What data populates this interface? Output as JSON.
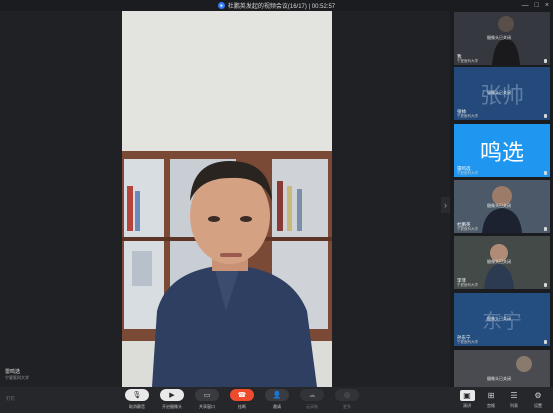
{
  "window": {
    "title": "杜鹏英发起的视频会议(16/17) | 00:52:57",
    "controls": [
      "—",
      "□",
      "×"
    ]
  },
  "main_speaker": {
    "name": "雷鸣选",
    "org": "宁夏医科大学"
  },
  "brand": "钉钉",
  "participants": [
    {
      "name": "我",
      "org": "宁夏医科大学",
      "camera_status": "摄像头已关闭",
      "avatar_text": "",
      "bg": "#2c2e33"
    },
    {
      "name": "张帅",
      "org": "宁夏医科大学",
      "camera_status": "摄像头已关闭",
      "avatar_text": "张帅",
      "bg": "#234a7a"
    },
    {
      "name": "雷鸣选",
      "org": "宁夏医科大学",
      "camera_status": "",
      "avatar_text": "鸣选",
      "bg": "#1f97f0"
    },
    {
      "name": "杜鹏英",
      "org": "宁夏医科大学",
      "camera_status": "摄像头已关闭",
      "avatar_text": "",
      "bg": "#3a4a5c"
    },
    {
      "name": "李菲",
      "org": "宁夏医科大学",
      "camera_status": "摄像头已关闭",
      "avatar_text": "",
      "bg": "#39413f"
    },
    {
      "name": "孙东宁",
      "org": "宁夏医科大学",
      "camera_status": "摄像头已关闭",
      "avatar_text": "东宁",
      "bg": "#244e7f"
    },
    {
      "name": "",
      "org": "",
      "camera_status": "摄像头已关闭",
      "avatar_text": "",
      "bg": "#3b3c40"
    }
  ],
  "toolbar": {
    "mute": "取消静音",
    "camera": "开启摄像头",
    "share": "共享窗口",
    "hangup": "挂断",
    "members": "邀请",
    "record": "云录制",
    "more": "更多",
    "layout": "演讲",
    "grid": "宫格",
    "list": "列表",
    "settings": "设置"
  },
  "colors": {
    "accent": "#1f97f0",
    "hangup": "#f04a2c",
    "background": "#202124"
  },
  "icons": {
    "collapse": "chevron-right-icon"
  }
}
